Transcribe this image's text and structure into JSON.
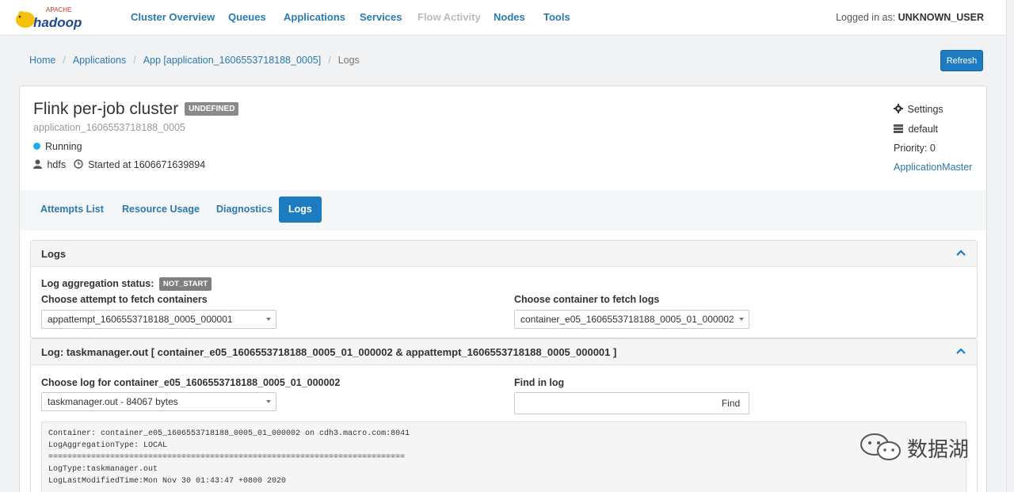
{
  "nav": {
    "logo_text": "hadoop",
    "logo_sub": "APACHE",
    "items": [
      {
        "label": "Cluster Overview",
        "enabled": true
      },
      {
        "label": "Queues",
        "enabled": true
      },
      {
        "label": "Applications",
        "enabled": true
      },
      {
        "label": "Services",
        "enabled": true
      },
      {
        "label": "Flow Activity",
        "enabled": false
      },
      {
        "label": "Nodes",
        "enabled": true
      },
      {
        "label": "Tools",
        "enabled": true
      }
    ],
    "login_label": "Logged in as:",
    "login_user": "UNKNOWN_USER"
  },
  "breadcrumb": {
    "items": [
      "Home",
      "Applications",
      "App [application_1606553718188_0005]"
    ],
    "current": "Logs",
    "separator": "/"
  },
  "refresh_label": "Refresh",
  "app": {
    "title": "Flink per-job cluster",
    "status_badge": "UNDEFINED",
    "id": "application_1606553718188_0005",
    "state": "Running",
    "user": "hdfs",
    "started": "Started at 1606671639894",
    "settings_label": "Settings",
    "queue": "default",
    "priority": "Priority: 0",
    "am_link": "ApplicationMaster"
  },
  "tabs": [
    "Attempts List",
    "Resource Usage",
    "Diagnostics",
    "Logs"
  ],
  "active_tab": "Logs",
  "logs_panel": {
    "title": "Logs",
    "aggregation_label": "Log aggregation status:",
    "aggregation_status": "NOT_START",
    "attempt_label": "Choose attempt to fetch containers",
    "attempt_value": "appattempt_1606553718188_0005_000001",
    "container_label": "Choose container to fetch logs",
    "container_value": "container_e05_1606553718188_0005_01_000002"
  },
  "log_panel": {
    "title": "Log: taskmanager.out [ container_e05_1606553718188_0005_01_000002 & appattempt_1606553718188_0005_000001 ]",
    "choose_log_label": "Choose log for container_e05_1606553718188_0005_01_000002",
    "log_file_value": "taskmanager.out - 84067 bytes",
    "find_label": "Find in log",
    "find_placeholder": "",
    "find_button": "Find",
    "content_lines": [
      "Container: container_e05_1606553718188_0005_01_000002 on cdh3.macro.com:8041",
      "LogAggregationType: LOCAL",
      "===========================================================================",
      "LogType:taskmanager.out",
      "LogLastModifiedTime:Mon Nov 30 01:43:47 +0800 2020"
    ]
  },
  "watermark": "数据湖",
  "colors": {
    "accent": "#1d7cbf",
    "link": "#2a7ab0",
    "running": "#1ab0e4"
  }
}
